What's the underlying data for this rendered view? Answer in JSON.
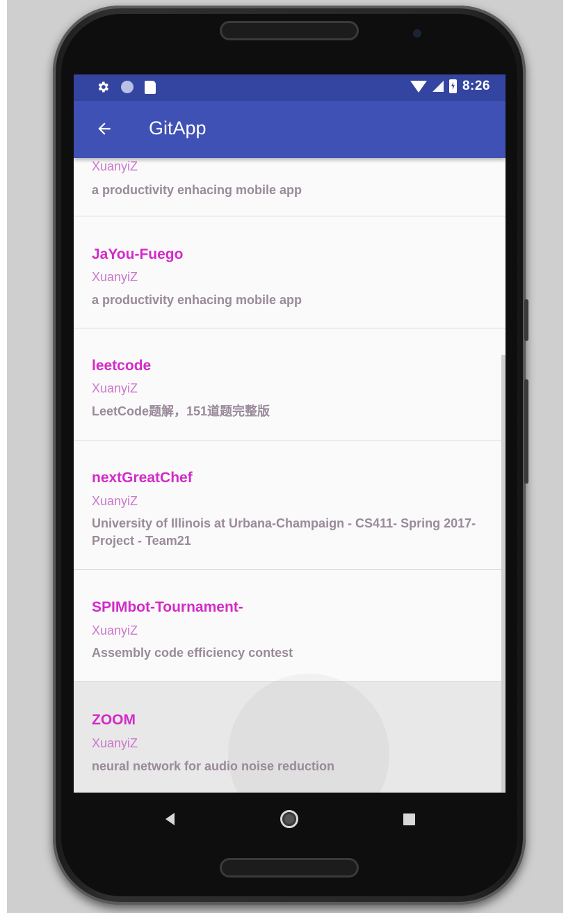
{
  "status_bar": {
    "time": "8:26",
    "left_icons": [
      "gear-icon",
      "circle-notification-icon",
      "sd-card-icon"
    ],
    "right_icons": [
      "wifi-icon",
      "cell-signal-icon",
      "battery-charging-icon"
    ]
  },
  "app_bar": {
    "title": "GitApp",
    "back_icon": "arrow-left-icon",
    "color": "#3f51b5"
  },
  "repos": [
    {
      "name": "",
      "owner": "XuanyiZ",
      "description": "a productivity enhacing mobile app"
    },
    {
      "name": "JaYou-Fuego",
      "owner": "XuanyiZ",
      "description": "a productivity enhacing mobile app"
    },
    {
      "name": "leetcode",
      "owner": "XuanyiZ",
      "description": "LeetCode题解，151道题完整版"
    },
    {
      "name": "nextGreatChef",
      "owner": "XuanyiZ",
      "description": "University of Illinois at Urbana-Champaign - CS411- Spring 2017- Project - Team21"
    },
    {
      "name": "SPIMbot-Tournament-",
      "owner": "XuanyiZ",
      "description": "Assembly code efficiency contest"
    },
    {
      "name": "ZOOM",
      "owner": "XuanyiZ",
      "description": "neural network for audio noise reduction"
    }
  ],
  "colors": {
    "status_bar": "#3345a0",
    "repo_name": "#d42ac8",
    "repo_owner": "#cc77cc",
    "repo_description": "#9a8a9a"
  },
  "nav_bar": {
    "buttons": [
      "back-triangle-icon",
      "home-circle-icon",
      "recents-square-icon"
    ]
  }
}
